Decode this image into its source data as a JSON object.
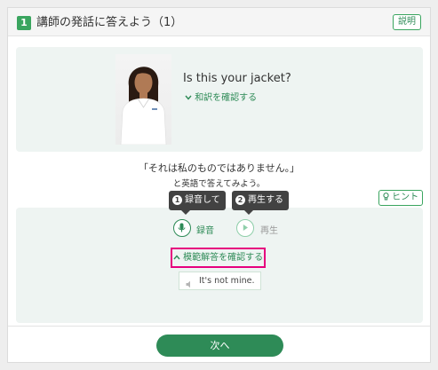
{
  "header": {
    "number": "1",
    "title": "講師の発話に答えよう（1）",
    "explain_label": "説明"
  },
  "question": {
    "english": "Is this your jacket?",
    "translation_toggle": "和訳を確認する"
  },
  "instruction": {
    "line1": "「それは私のものではありません。」",
    "line2": "と英語で答えてみよう。"
  },
  "hint_label": "ヒント",
  "tooltips": {
    "record": {
      "num": "1",
      "label": "録音して"
    },
    "play": {
      "num": "2",
      "label": "再生する"
    }
  },
  "controls": {
    "record_label": "録音",
    "play_label": "再生"
  },
  "model_answer": {
    "toggle": "模範解答を確認する",
    "text": "It's not mine."
  },
  "next_label": "次へ",
  "colors": {
    "accent": "#2e8b57",
    "highlight": "#e6007e",
    "panel": "#eef4f2"
  }
}
